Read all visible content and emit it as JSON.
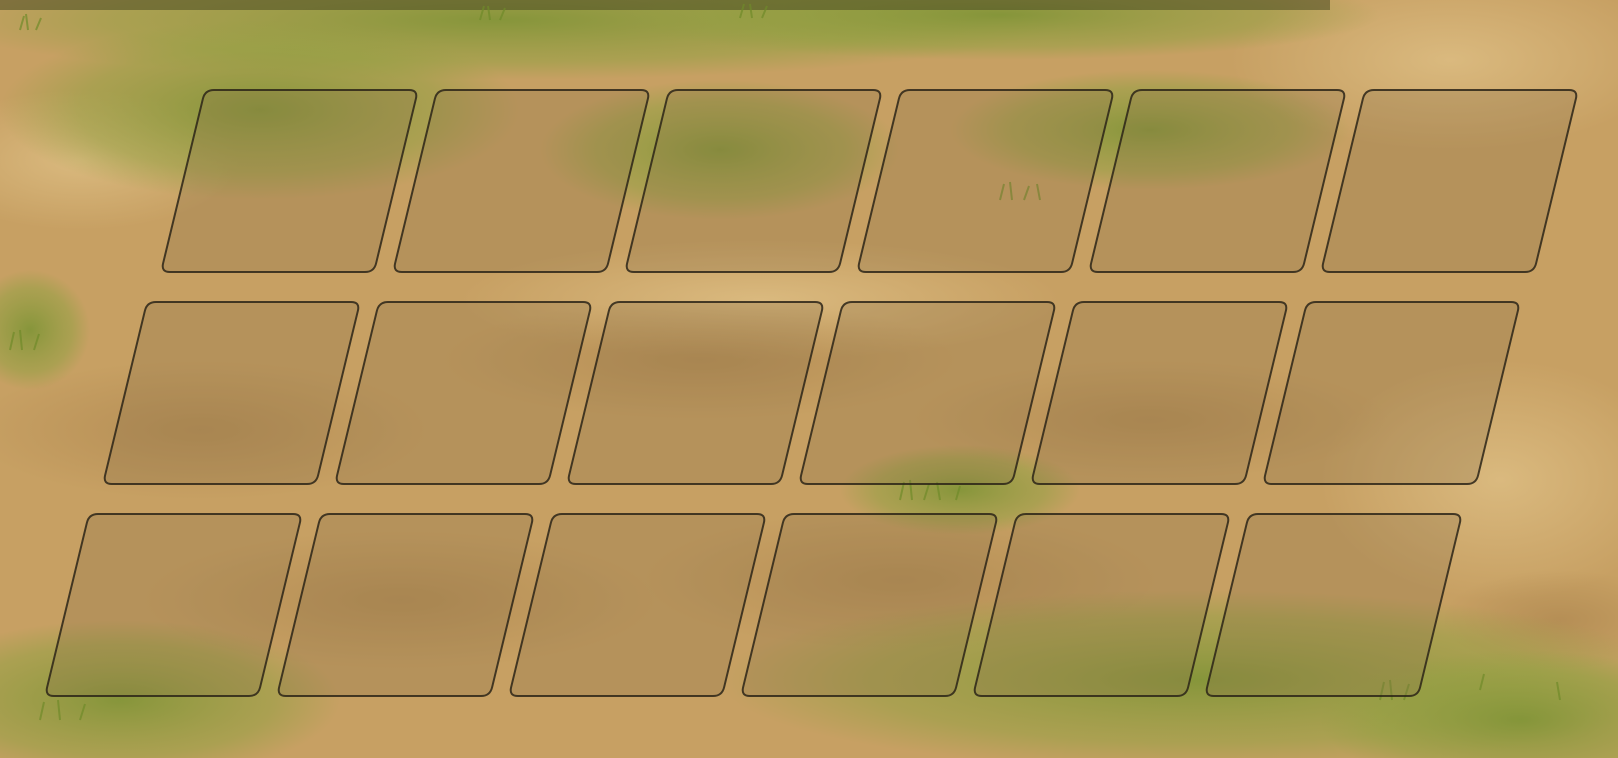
{
  "scene": {
    "type": "battle-formation-grid",
    "rows": 3,
    "cols": 6,
    "slots": [
      {
        "row": 1,
        "col": 1,
        "occupied": false
      },
      {
        "row": 1,
        "col": 2,
        "occupied": false
      },
      {
        "row": 1,
        "col": 3,
        "occupied": false
      },
      {
        "row": 1,
        "col": 4,
        "occupied": false
      },
      {
        "row": 1,
        "col": 5,
        "occupied": false
      },
      {
        "row": 1,
        "col": 6,
        "occupied": false
      },
      {
        "row": 2,
        "col": 1,
        "occupied": false
      },
      {
        "row": 2,
        "col": 2,
        "occupied": false
      },
      {
        "row": 2,
        "col": 3,
        "occupied": false
      },
      {
        "row": 2,
        "col": 4,
        "occupied": false
      },
      {
        "row": 2,
        "col": 5,
        "occupied": false
      },
      {
        "row": 2,
        "col": 6,
        "occupied": false
      },
      {
        "row": 3,
        "col": 1,
        "occupied": false
      },
      {
        "row": 3,
        "col": 2,
        "occupied": false
      },
      {
        "row": 3,
        "col": 3,
        "occupied": false
      },
      {
        "row": 3,
        "col": 4,
        "occupied": false
      },
      {
        "row": 3,
        "col": 5,
        "occupied": false
      },
      {
        "row": 3,
        "col": 6,
        "occupied": false
      }
    ]
  },
  "colors": {
    "ground": "#c9a264",
    "ground_dark": "#a7804a",
    "grass": "#8a9a3a",
    "grass_light": "#b4b84a",
    "tile_fill": "#8a7048",
    "tile_border": "#2b2418"
  }
}
